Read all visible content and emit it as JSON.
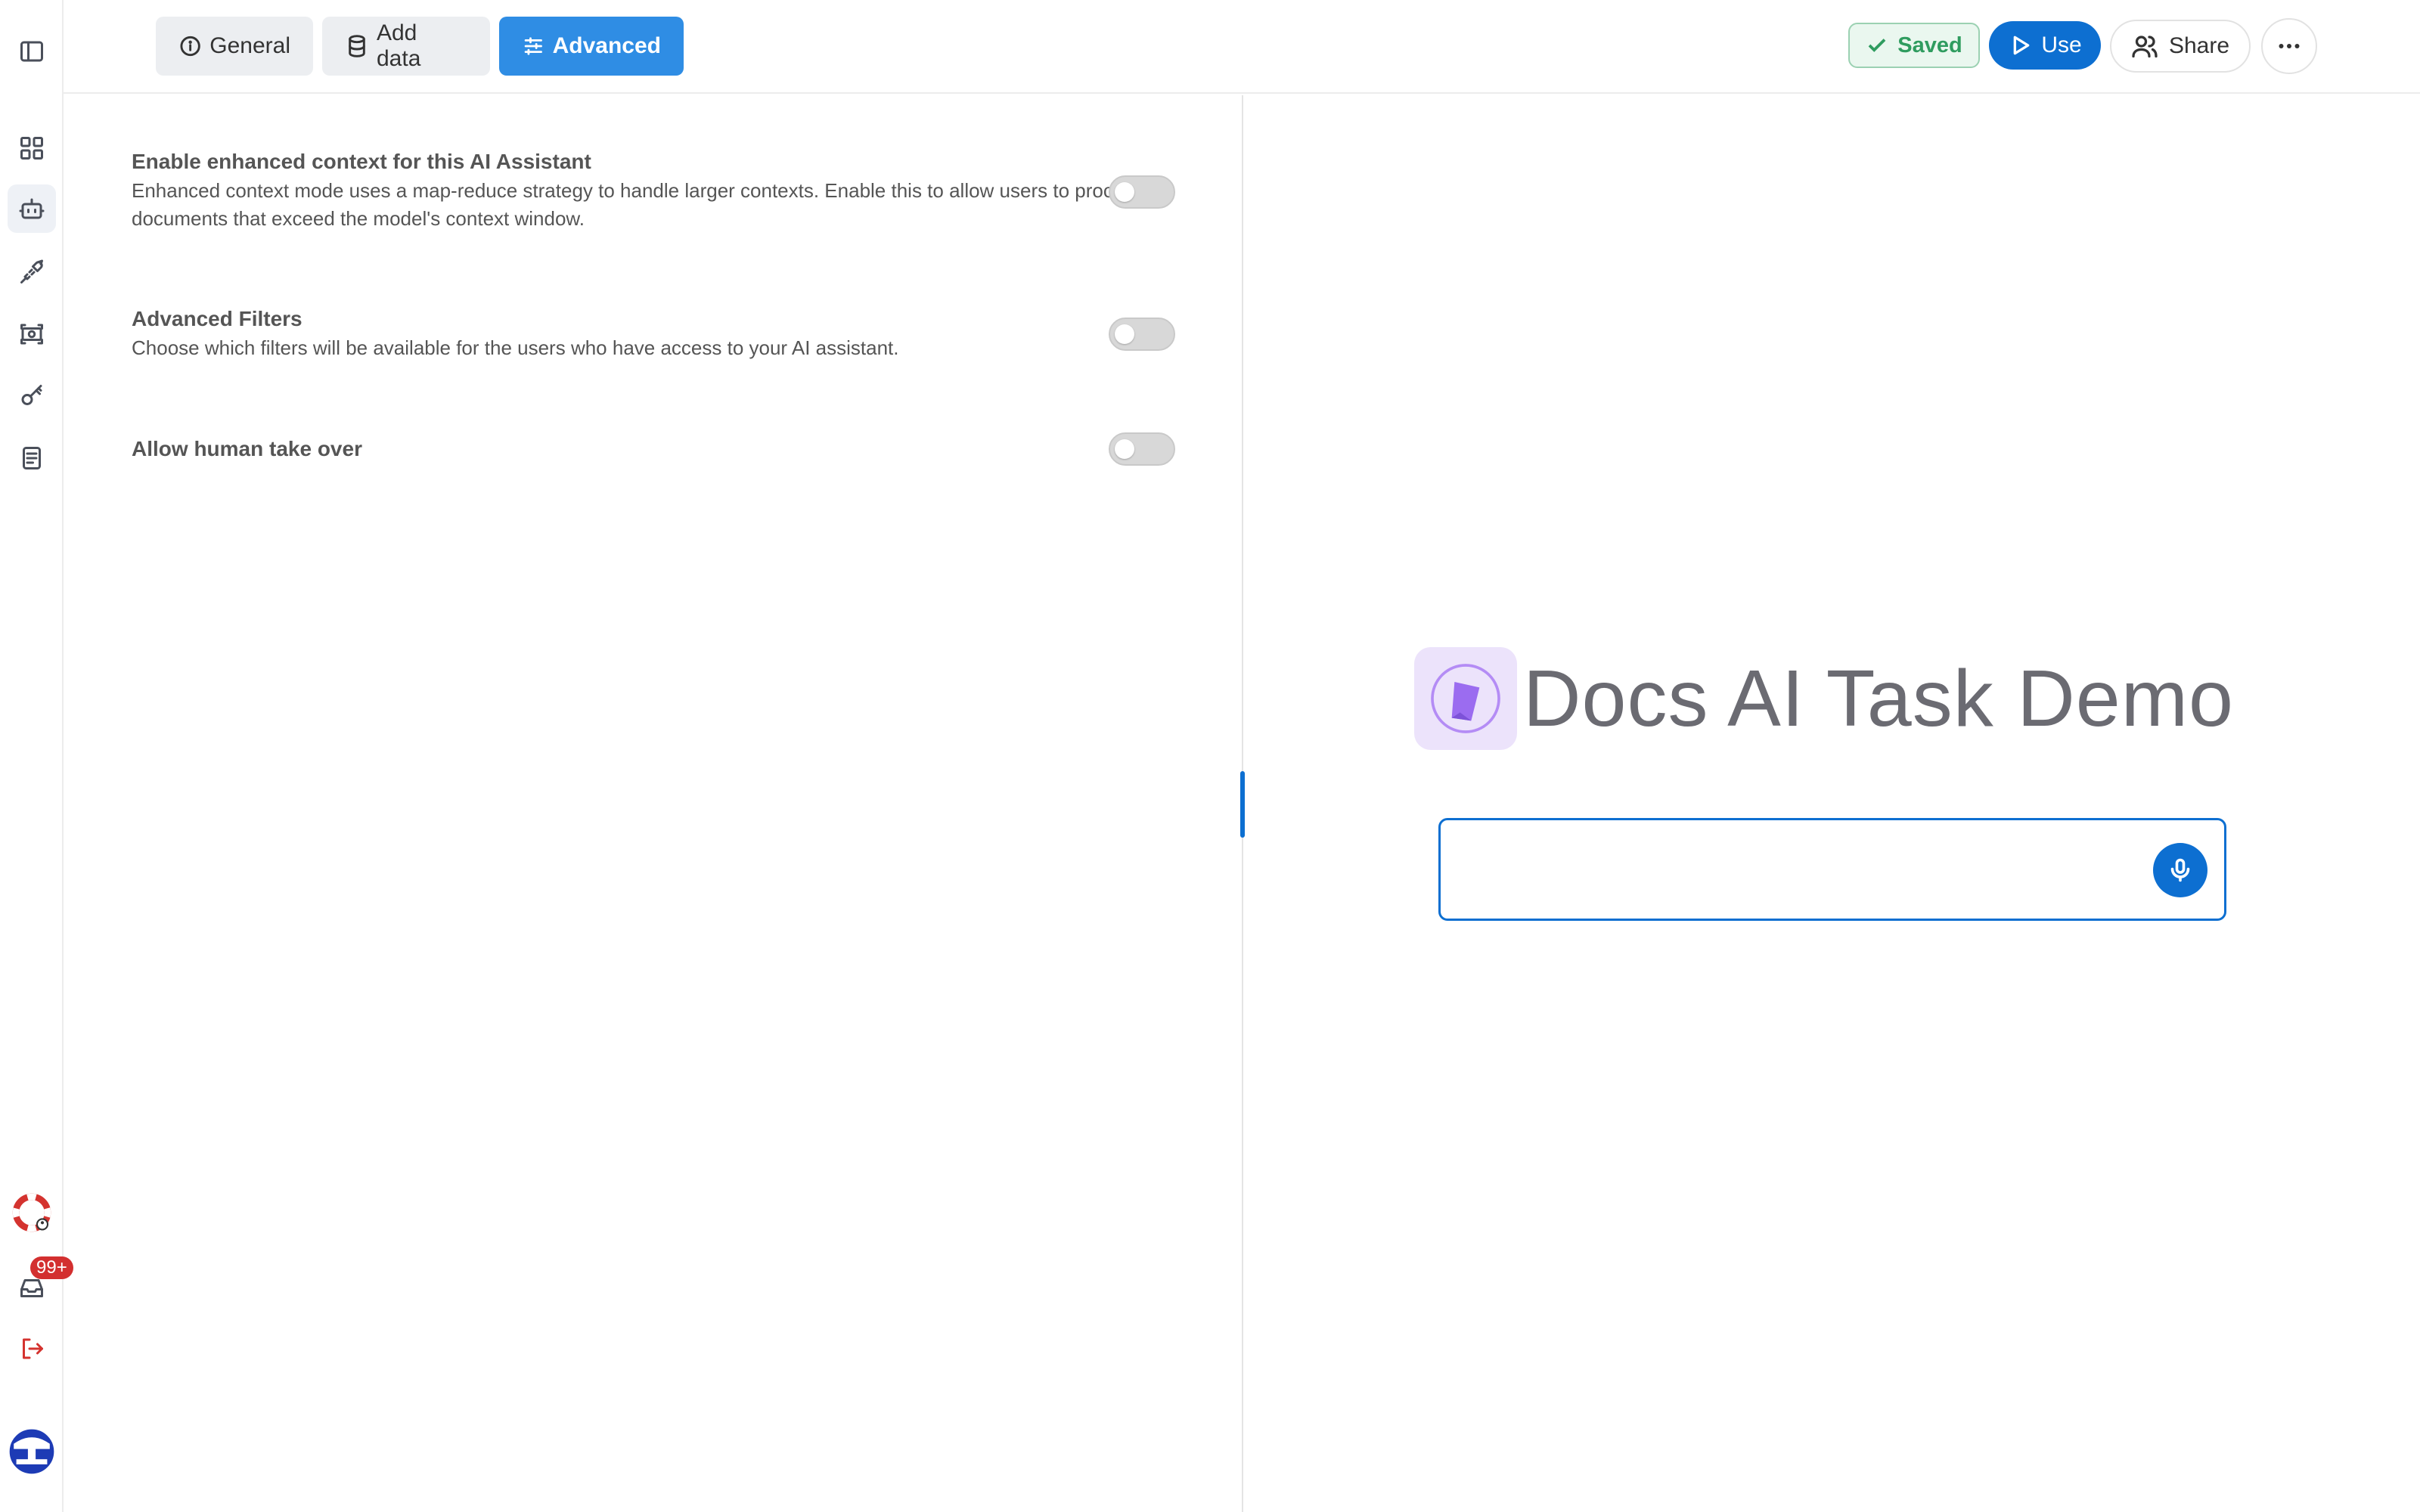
{
  "tabs": [
    {
      "label": "General",
      "icon": "info-icon"
    },
    {
      "label": "Add data",
      "icon": "database-icon"
    },
    {
      "label": "Advanced",
      "icon": "sliders-icon",
      "active": true
    }
  ],
  "header": {
    "saved_label": "Saved",
    "use_label": "Use",
    "share_label": "Share"
  },
  "sidebar": {
    "items": [
      {
        "icon": "panel-toggle-icon"
      },
      {
        "icon": "dashboard-grid-icon"
      },
      {
        "icon": "bot-icon",
        "active": true
      },
      {
        "icon": "plug-icon"
      },
      {
        "icon": "screen-capture-icon"
      },
      {
        "icon": "key-icon"
      },
      {
        "icon": "document-icon"
      }
    ],
    "bottom": {
      "support_icon": "lifebuoy-icon",
      "inbox_badge": "99+",
      "logout_icon": "logout-icon",
      "avatar_icon": "user-avatar-icon"
    }
  },
  "settings": [
    {
      "title": "Enable enhanced context for this AI Assistant",
      "description": "Enhanced context mode uses a map-reduce strategy to handle larger contexts. Enable this to allow users to process documents that exceed the model's context window.",
      "enabled": false
    },
    {
      "title": "Advanced Filters",
      "description": "Choose which filters will be available for the users who have access to your AI assistant.",
      "enabled": false
    },
    {
      "title": "Allow human take over",
      "description": "",
      "enabled": false
    }
  ],
  "preview": {
    "title": "Docs AI Task Demo",
    "input_placeholder": ""
  },
  "colors": {
    "accent": "#0d6fd1",
    "tab_active": "#2f8de4",
    "saved_green": "#2f9c5f",
    "logo_bg": "#ece3fb",
    "logo_purple": "#9b6cf0",
    "danger": "#d4332f"
  }
}
